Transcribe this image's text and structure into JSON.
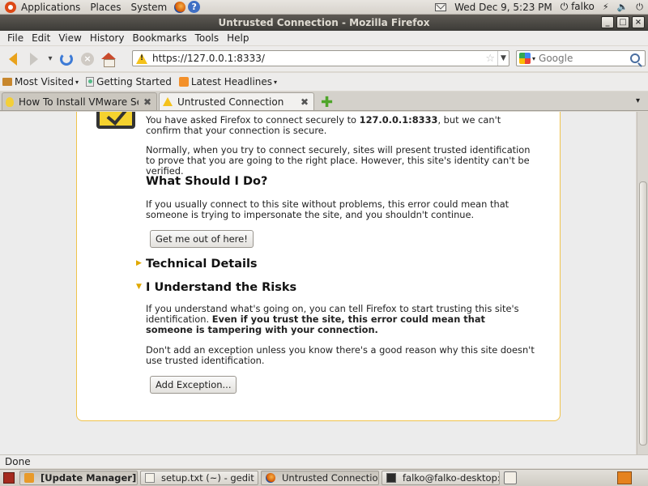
{
  "top_panel": {
    "menus": [
      "Applications",
      "Places",
      "System"
    ],
    "clock": "Wed Dec  9,  5:23 PM",
    "user": "falko"
  },
  "window": {
    "title": "Untrusted Connection - Mozilla Firefox",
    "buttons": {
      "minimize": "_",
      "maximize": "□",
      "close": "×"
    }
  },
  "menubar": [
    "File",
    "Edit",
    "View",
    "History",
    "Bookmarks",
    "Tools",
    "Help"
  ],
  "navbar": {
    "url": "https://127.0.0.1:8333/",
    "search_placeholder": "Google"
  },
  "bookmarks": [
    "Most Visited",
    "Getting Started",
    "Latest Headlines"
  ],
  "tabs": [
    {
      "label": "How To Install VMware Ser...",
      "active": false
    },
    {
      "label": "Untrusted Connection",
      "active": true
    }
  ],
  "page": {
    "p1_before": "You have asked Firefox to connect securely to ",
    "p1_host": "127.0.0.1:8333",
    "p1_after": ", but we can't confirm that your connection is secure.",
    "p2": "Normally, when you try to connect securely, sites will present trusted identification to prove that you are going to the right place. However, this site's identity can't be verified.",
    "h_what": "What Should I Do?",
    "p3": "If you usually connect to this site without problems, this error could mean that someone is trying to impersonate the site, and you shouldn't continue.",
    "btn_getout": "Get me out of here!",
    "h_technical": "Technical Details",
    "h_risks": "I Understand the Risks",
    "p4_before": "If you understand what's going on, you can tell Firefox to start trusting this site's identification. ",
    "p4_bold": "Even if you trust the site, this error could mean that someone is tampering with your connection.",
    "p5": "Don't add an exception unless you know there's a good reason why this site doesn't use trusted identification.",
    "btn_exception": "Add Exception..."
  },
  "status": "Done",
  "taskbar": [
    {
      "label": "[Update Manager]",
      "pressed": true
    },
    {
      "label": "setup.txt (~) - gedit",
      "pressed": false
    },
    {
      "label": "Untrusted Connectio...",
      "pressed": true
    },
    {
      "label": "falko@falko-desktop:...",
      "pressed": false
    }
  ],
  "colors": {
    "titlebar": "#3c3b37",
    "warning_yellow": "#f4c21c",
    "error_border": "#f0c34c",
    "firefox_orange": "#e9a21b"
  }
}
